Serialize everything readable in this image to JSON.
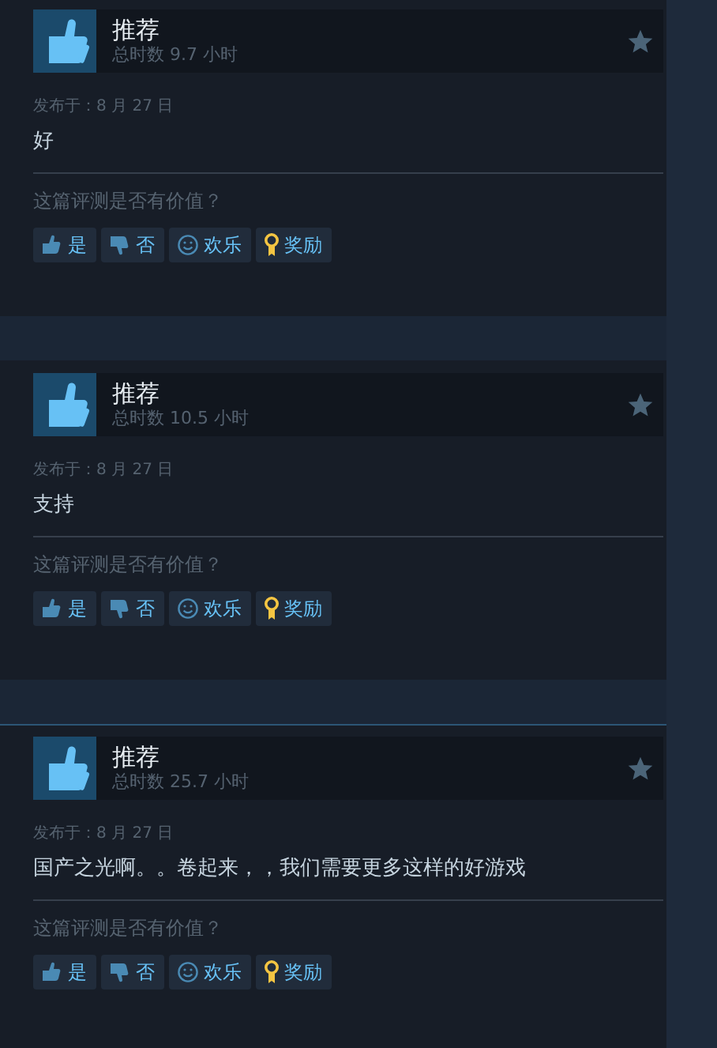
{
  "reviews": [
    {
      "verdict": "推荐",
      "hours": "总时数 9.7 小时",
      "posted": "发布于：8 月 27 日",
      "text": "好",
      "question": "这篇评测是否有价值？",
      "highlighted": false,
      "buttons": [
        {
          "kind": "up",
          "label": "是"
        },
        {
          "kind": "down",
          "label": "否"
        },
        {
          "kind": "funny",
          "label": "欢乐"
        },
        {
          "kind": "award",
          "label": "奖励"
        }
      ]
    },
    {
      "verdict": "推荐",
      "hours": "总时数 10.5 小时",
      "posted": "发布于：8 月 27 日",
      "text": "支持",
      "question": "这篇评测是否有价值？",
      "highlighted": false,
      "buttons": [
        {
          "kind": "up",
          "label": "是"
        },
        {
          "kind": "down",
          "label": "否"
        },
        {
          "kind": "funny",
          "label": "欢乐"
        },
        {
          "kind": "award",
          "label": "奖励"
        }
      ]
    },
    {
      "verdict": "推荐",
      "hours": "总时数 25.7 小时",
      "posted": "发布于：8 月 27 日",
      "text": "国产之光啊。。卷起来，，我们需要更多这样的好游戏",
      "question": "这篇评测是否有价值？",
      "highlighted": true,
      "buttons": [
        {
          "kind": "up",
          "label": "是"
        },
        {
          "kind": "down",
          "label": "否"
        },
        {
          "kind": "funny",
          "label": "欢乐"
        },
        {
          "kind": "award",
          "label": "奖励"
        }
      ]
    }
  ]
}
